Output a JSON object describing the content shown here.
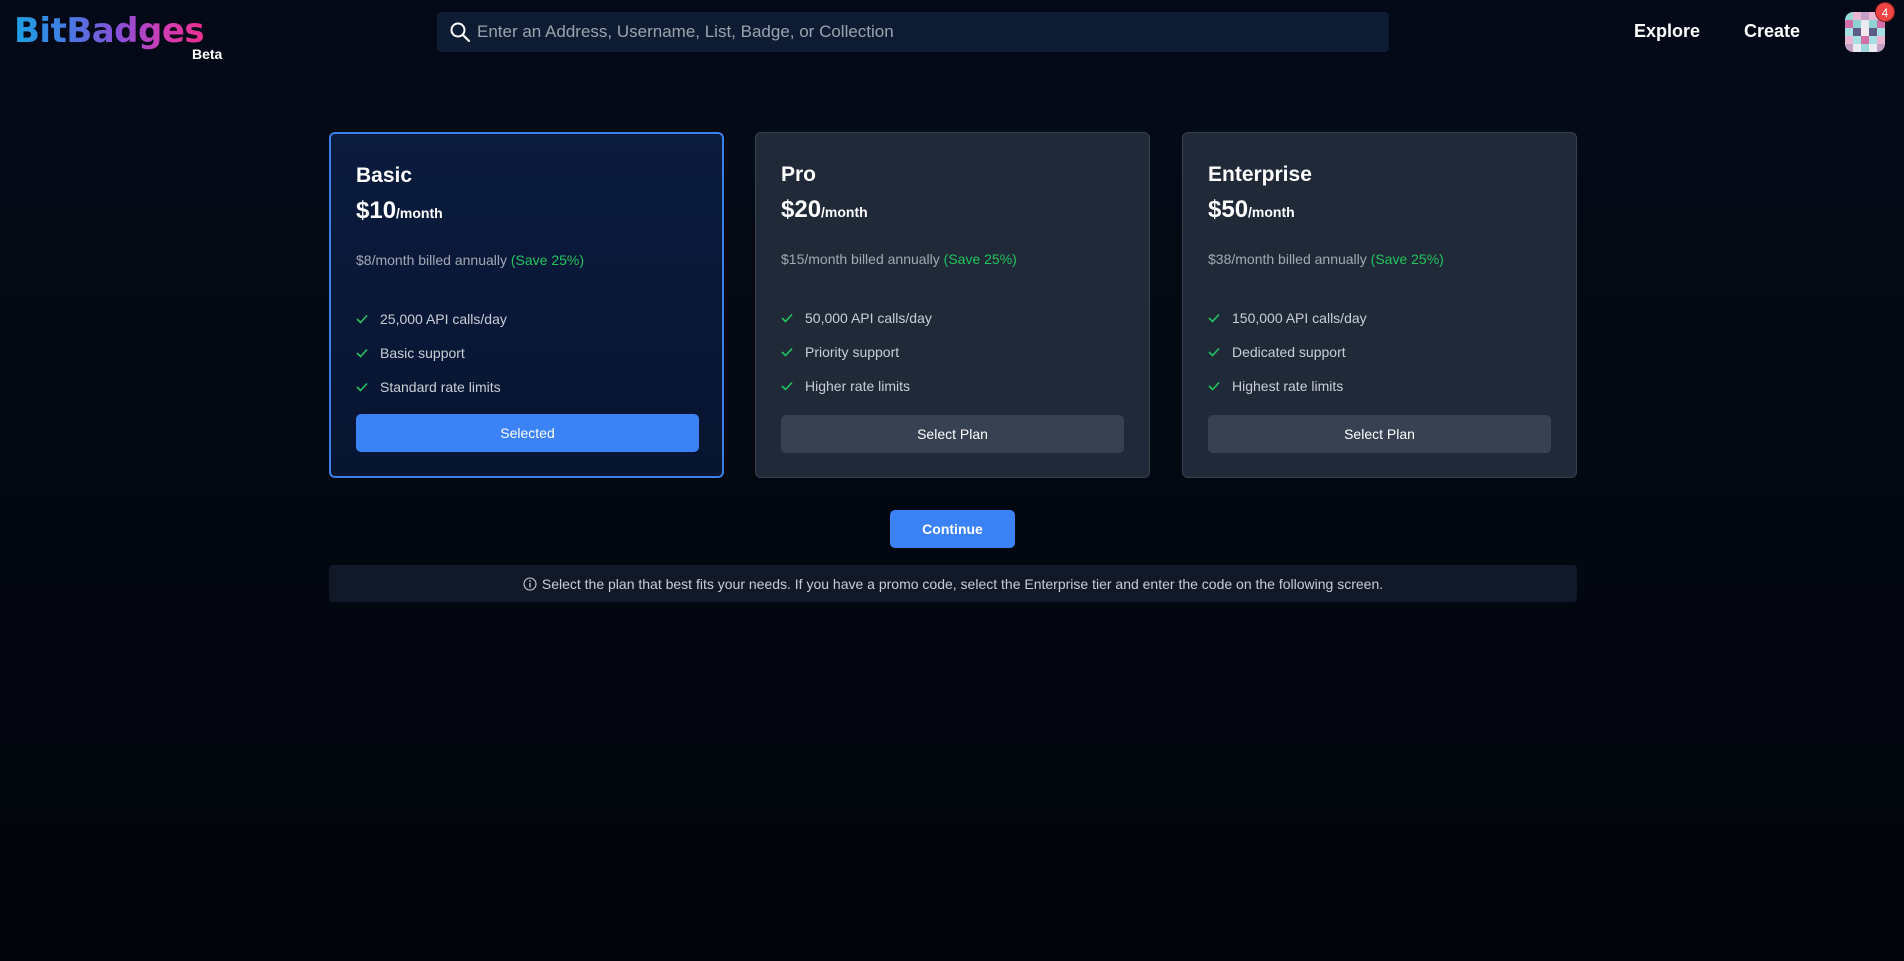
{
  "header": {
    "logo": "BitBadges",
    "beta_label": "Beta",
    "search_placeholder": "Enter an Address, Username, List, Badge, or Collection",
    "nav": {
      "explore": "Explore",
      "create": "Create"
    },
    "notification_count": "4"
  },
  "plans": [
    {
      "name": "Basic",
      "price": "$10",
      "period": "/month",
      "annual": "$8/month billed annually",
      "save": "(Save 25%)",
      "features": [
        "25,000 API calls/day",
        "Basic support",
        "Standard rate limits"
      ],
      "button": "Selected"
    },
    {
      "name": "Pro",
      "price": "$20",
      "period": "/month",
      "annual": "$15/month billed annually",
      "save": "(Save 25%)",
      "features": [
        "50,000 API calls/day",
        "Priority support",
        "Higher rate limits"
      ],
      "button": "Select Plan"
    },
    {
      "name": "Enterprise",
      "price": "$50",
      "period": "/month",
      "annual": "$38/month billed annually",
      "save": "(Save 25%)",
      "features": [
        "150,000 API calls/day",
        "Dedicated support",
        "Highest rate limits"
      ],
      "button": "Select Plan"
    }
  ],
  "continue_label": "Continue",
  "info_text": "Select the plan that best fits your needs. If you have a promo code, select the Enterprise tier and enter the code on the following screen.",
  "colors": {
    "accent": "#3b82f6",
    "save_green": "#22c55e",
    "card_bg": "#1f2937"
  }
}
